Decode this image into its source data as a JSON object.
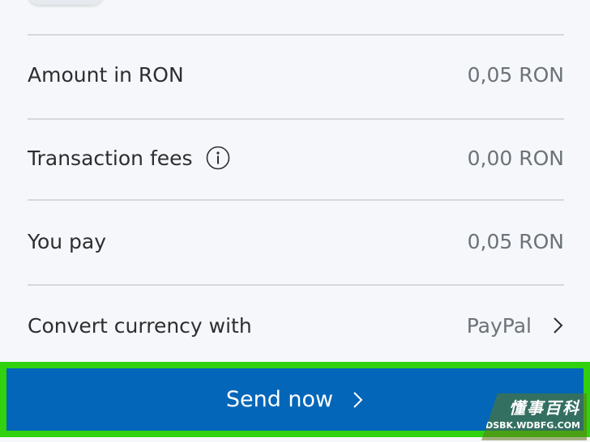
{
  "rows": [
    {
      "label": "Amount in RON",
      "value": "0,05 RON"
    },
    {
      "label": "Transaction fees",
      "value": "0,00 RON",
      "icon": "info-icon"
    },
    {
      "label": "You pay",
      "value": "0,05 RON"
    },
    {
      "label": "Convert currency with",
      "value": "PayPal",
      "icon": "chevron-right-icon"
    }
  ],
  "send_button": {
    "label": "Send now",
    "icon": "chevron-right-icon",
    "background": "#0366b8",
    "highlight_outline": "#31d10f"
  },
  "watermark": {
    "title": "懂事百科",
    "subtitle": "DSBK.WDBFG.COM"
  },
  "colors": {
    "background": "#f5f7fa",
    "label_text": "#2c2e2f",
    "value_text": "#6c7378",
    "divider": "#d5d8dd"
  }
}
